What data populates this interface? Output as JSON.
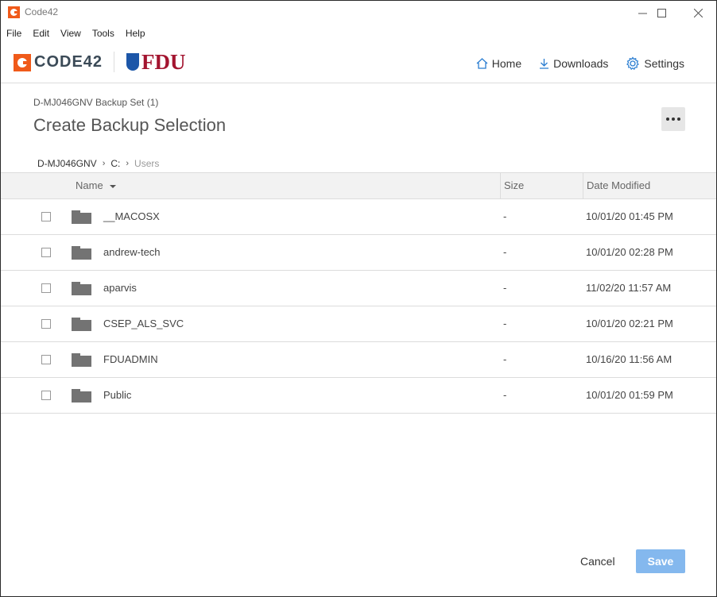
{
  "window": {
    "title": "Code42",
    "controls": [
      "minimize",
      "maximize",
      "close"
    ]
  },
  "menu": [
    "File",
    "Edit",
    "View",
    "Tools",
    "Help"
  ],
  "header": {
    "brand": "CODE42",
    "partner": "FDU",
    "nav": [
      {
        "label": "Home",
        "icon": "home-icon"
      },
      {
        "label": "Downloads",
        "icon": "download-icon"
      },
      {
        "label": "Settings",
        "icon": "gear-icon"
      }
    ]
  },
  "page": {
    "subtitle": "D-MJ046GNV Backup Set (1)",
    "title": "Create Backup Selection"
  },
  "breadcrumb": [
    "D-MJ046GNV",
    "C:",
    "Users"
  ],
  "table": {
    "columns": {
      "name": "Name",
      "size": "Size",
      "date": "Date Modified"
    },
    "rows": [
      {
        "name": "__MACOSX",
        "size": "-",
        "date": "10/01/20 01:45 PM",
        "checked": false
      },
      {
        "name": "andrew-tech",
        "size": "-",
        "date": "10/01/20 02:28 PM",
        "checked": false
      },
      {
        "name": "aparvis",
        "size": "-",
        "date": "11/02/20 11:57 AM",
        "checked": false
      },
      {
        "name": "CSEP_ALS_SVC",
        "size": "-",
        "date": "10/01/20 02:21 PM",
        "checked": false
      },
      {
        "name": "FDUADMIN",
        "size": "-",
        "date": "10/16/20 11:56 AM",
        "checked": false
      },
      {
        "name": "Public",
        "size": "-",
        "date": "10/01/20 01:59 PM",
        "checked": false
      }
    ]
  },
  "footer": {
    "cancel": "Cancel",
    "save": "Save"
  },
  "colors": {
    "brand_orange": "#f05a1a",
    "fdu_red": "#a3142f",
    "accent_blue": "#2a7dd1",
    "save_disabled": "#84b8ee"
  }
}
